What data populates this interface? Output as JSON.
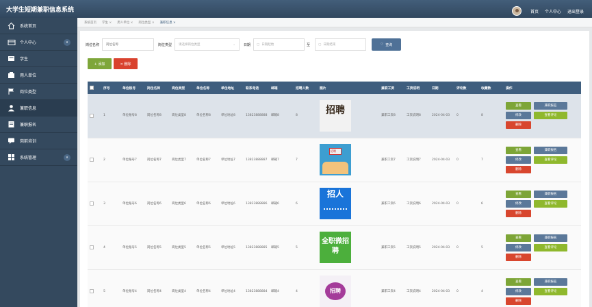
{
  "app": {
    "title": "大学生短期兼职信息系统",
    "nav_home": "首页",
    "nav_profile": "个人中心",
    "nav_logout": "退出登录"
  },
  "sidebar": {
    "items": [
      {
        "label": "系统首页",
        "icon": "home-icon"
      },
      {
        "label": "个人中心",
        "icon": "card-icon",
        "chevron": "∨"
      },
      {
        "label": "学生",
        "icon": "student-icon"
      },
      {
        "label": "用人单位",
        "icon": "building-icon"
      },
      {
        "label": "岗位类型",
        "icon": "flag-icon"
      },
      {
        "label": "兼职信息",
        "icon": "user-icon"
      },
      {
        "label": "兼职报名",
        "icon": "form-icon"
      },
      {
        "label": "岗前培训",
        "icon": "chat-icon"
      },
      {
        "label": "系统管理",
        "icon": "grid-icon",
        "chevron": "∨"
      }
    ]
  },
  "tabs": [
    "系统首页",
    "学生 ×",
    "用人单位 ×",
    "岗位类型 ×",
    "兼职信息 ×"
  ],
  "search": {
    "name_label": "岗位名称",
    "name_placeholder": "岗位名称",
    "type_label": "岗位类型",
    "type_placeholder": "请选择岗位类型",
    "date_label": "日期",
    "date_from": "日期起始",
    "date_sep": "至",
    "date_to": "日期结束",
    "query": "查询"
  },
  "actions": {
    "add": "+ 添加",
    "delete": "✕ 删除"
  },
  "table": {
    "headers": [
      "",
      "序号",
      "单位账号",
      "岗位名称",
      "岗位类型",
      "单位名称",
      "单位地址",
      "联系电话",
      "邮箱",
      "招聘人数",
      "图片",
      "兼职工资",
      "工资说明",
      "日期",
      "评论数",
      "收藏数",
      "操作"
    ],
    "rows": [
      {
        "idx": "1",
        "account": "单位账号8",
        "post": "岗位名称8",
        "type": "岗位类型8",
        "unit": "单位名称8",
        "addr": "单位地址8",
        "phone": "13823888888",
        "email": "邮箱8",
        "count": "8",
        "salary": "兼职工资8",
        "desc": "工资说明8",
        "date": "2024-04-03",
        "comments": "0",
        "fav": "8",
        "pic_text": "招聘"
      },
      {
        "idx": "2",
        "account": "单位账号7",
        "post": "岗位名称7",
        "type": "岗位类型7",
        "unit": "单位名称7",
        "addr": "单位地址7",
        "phone": "13823888887",
        "email": "邮箱7",
        "count": "7",
        "salary": "兼职工资7",
        "desc": "工资说明7",
        "date": "2024-04-03",
        "comments": "0",
        "fav": "7",
        "pic_text": "招聘"
      },
      {
        "idx": "3",
        "account": "单位账号6",
        "post": "岗位名称6",
        "type": "岗位类型6",
        "unit": "单位名称6",
        "addr": "单位地址6",
        "phone": "13823888886",
        "email": "邮箱6",
        "count": "6",
        "salary": "兼职工资6",
        "desc": "工资说明6",
        "date": "2024-04-03",
        "comments": "0",
        "fav": "6",
        "pic_text": "招人"
      },
      {
        "idx": "4",
        "account": "单位账号5",
        "post": "岗位名称5",
        "type": "岗位类型5",
        "unit": "单位名称5",
        "addr": "单位地址5",
        "phone": "13823888885",
        "email": "邮箱5",
        "count": "5",
        "salary": "兼职工资5",
        "desc": "工资说明5",
        "date": "2024-04-03",
        "comments": "0",
        "fav": "5",
        "pic_text": "全职微招聘"
      },
      {
        "idx": "5",
        "account": "单位账号4",
        "post": "岗位名称4",
        "type": "岗位类型4",
        "unit": "单位名称4",
        "addr": "单位地址4",
        "phone": "13823888884",
        "email": "邮箱4",
        "count": "4",
        "salary": "兼职工资4",
        "desc": "工资说明4",
        "date": "2024-04-03",
        "comments": "0",
        "fav": "4",
        "pic_text": "招聘"
      }
    ],
    "btn": {
      "view": "查看",
      "signup": "兼职报名",
      "edit": "修改",
      "review": "查看评论",
      "del": "删除"
    }
  }
}
